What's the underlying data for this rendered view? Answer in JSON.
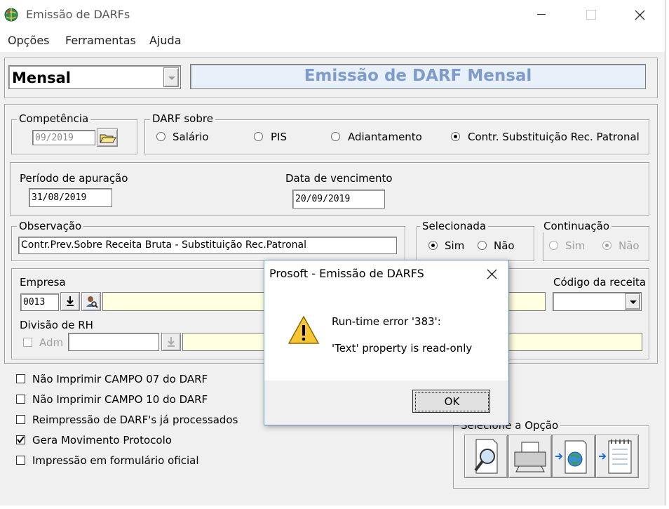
{
  "window": {
    "title": "Emissão de DARFs"
  },
  "menu": [
    "Opções",
    "Ferramentas",
    "Ajuda"
  ],
  "period_select": {
    "value": "Mensal"
  },
  "banner": {
    "text": "Emissão de DARF Mensal"
  },
  "competencia": {
    "label": "Competência",
    "value": "09/2019"
  },
  "darf_sobre": {
    "label": "DARF sobre",
    "options": [
      "Salário",
      "PIS",
      "Adiantamento",
      "Contr. Substituição Rec. Patronal"
    ],
    "selected": "Contr. Substituição Rec. Patronal"
  },
  "periodo": {
    "label": "Período de apuração",
    "value": "31/08/2019"
  },
  "vencimento": {
    "label": "Data de vencimento",
    "value": "20/09/2019"
  },
  "observacao": {
    "label": "Observação",
    "value": "Contr.Prev.Sobre Receita Bruta - Substituição Rec.Patronal"
  },
  "selecionada": {
    "label": "Selecionada",
    "options": [
      "Sim",
      "Não"
    ],
    "selected": "Sim"
  },
  "continuacao": {
    "label": "Continuação",
    "options": [
      "Sim",
      "Não"
    ],
    "selected": "Não"
  },
  "empresa": {
    "label": "Empresa",
    "value": "0013"
  },
  "codigo_receita": {
    "label": "Código da receita",
    "value": ""
  },
  "divisao_rh": {
    "label": "Divisão de RH",
    "adm_label": "Adm"
  },
  "checkboxes": [
    {
      "label": "Não Imprimir CAMPO 07 do DARF",
      "checked": false
    },
    {
      "label": "Não Imprimir CAMPO 10 do DARF",
      "checked": false
    },
    {
      "label": "Reimpressão de DARF's já processados",
      "checked": false
    },
    {
      "label": "Gera Movimento Protocolo",
      "checked": true
    },
    {
      "label": "Impressão em formulário oficial",
      "checked": false
    }
  ],
  "selecione": {
    "label": "Selecione a Opção"
  },
  "dialog": {
    "title": "Prosoft - Emissão de DARFS",
    "line1": "Run-time error '383':",
    "line2": "'Text' property is read-only",
    "ok": "OK"
  },
  "colors": {
    "banner_text": "#7f9bc9",
    "yellow_field": "#ffffe1",
    "dialog_border": "#6b9bd1"
  }
}
